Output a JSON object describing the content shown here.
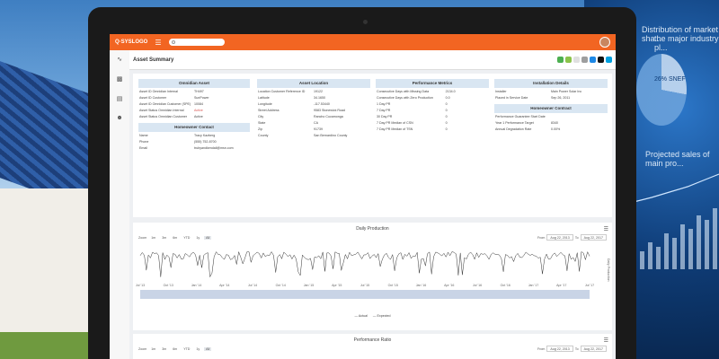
{
  "background": {
    "headline": "Distribution of market sha...",
    "subheadline": "the major industry pl...",
    "pie_label": "26% SNEF",
    "projected_text": "Projected sales of main pro..."
  },
  "app": {
    "brand": "Q·SYSLOGO",
    "page_title": "Asset Summary",
    "accent": "#f26522"
  },
  "omnidian": {
    "title": "Omnidian Asset",
    "rows": [
      {
        "k": "Asset ID Omnidian Internal",
        "v": "TH497"
      },
      {
        "k": "Asset ID Customer",
        "v": "SunPower"
      },
      {
        "k": "Asset ID Omnidian Customer (SPE)",
        "v": "10084"
      },
      {
        "k": "Asset Status Omnidian Internal",
        "v": "Active"
      },
      {
        "k": "Asset Status Omnidian Customer",
        "v": "Active"
      }
    ]
  },
  "homeowner": {
    "title": "Homeowner Contact",
    "rows": [
      {
        "k": "Name",
        "v": "Tracy Kazberg"
      },
      {
        "k": "Phone",
        "v": "(555) 752-8700"
      },
      {
        "k": "Email",
        "v": "trubyandkendall@msn.com"
      }
    ]
  },
  "location": {
    "title": "Asset Location",
    "rows": [
      {
        "k": "Location Customer Reference ID",
        "v": "19122"
      },
      {
        "k": "Latitude",
        "v": "34.1650"
      },
      {
        "k": "Longitude",
        "v": "-117.53440"
      },
      {
        "k": "Street Address",
        "v": "9583 Stonewick Road"
      },
      {
        "k": "City",
        "v": "Rancho Cucamonga"
      },
      {
        "k": "State",
        "v": "CA"
      },
      {
        "k": "Zip",
        "v": "91739"
      },
      {
        "k": "County",
        "v": "San Bernardino County"
      }
    ]
  },
  "performance": {
    "title": "Performance Metrics",
    "rows": [
      {
        "k": "Consecutive Days with Missing Data",
        "v": "2134.0"
      },
      {
        "k": "Consecutive Days with Zero Production",
        "v": "0.0"
      },
      {
        "k": "1 Day PR",
        "v": "0"
      },
      {
        "k": "7 Day PR",
        "v": "0"
      },
      {
        "k": "30 Day PR",
        "v": "0"
      },
      {
        "k": "7 Day PR Median of CSN",
        "v": "0"
      },
      {
        "k": "7 Day PR Median of TSN",
        "v": "0"
      }
    ]
  },
  "installation": {
    "title": "Installation Details",
    "rows": [
      {
        "k": "Installer",
        "v": "Main Power Solar Inc"
      },
      {
        "k": "Placed in Service Date",
        "v": "Sep 26, 2011"
      }
    ]
  },
  "homeowner_contract": {
    "title": "Homeowner Contract",
    "rows": [
      {
        "k": "Performance Guarantee Start Date",
        "v": ""
      },
      {
        "k": "Year 1 Performance Target",
        "v": "8340"
      },
      {
        "k": "Annual Degradation Rate",
        "v": "0.00%"
      }
    ]
  },
  "daily_chart": {
    "title": "Daily Production",
    "zoom_label": "Zoom",
    "zoom_options": [
      "1m",
      "3m",
      "6m",
      "YTD",
      "1y",
      "All"
    ],
    "active_zoom": "All",
    "from_label": "From",
    "to_label": "To",
    "from_date": "Aug 22, 2013",
    "to_date": "Aug 22, 2017",
    "x_ticks": [
      "Jul '13",
      "Oct '13",
      "Jan '14",
      "Apr '14",
      "Jul '14",
      "Oct '14",
      "Jan '15",
      "Apr '15",
      "Jul '15",
      "Oct '15",
      "Jan '16",
      "Apr '16",
      "Jul '16",
      "Oct '16",
      "Jan '17",
      "Apr '17",
      "Jul '17"
    ],
    "y_axis_label": "Daily Production",
    "legend_actual": "Actual",
    "legend_expected": "Expected"
  },
  "ratio_chart": {
    "title": "Performance Ratio",
    "zoom_label": "Zoom",
    "zoom_options": [
      "1m",
      "3m",
      "6m",
      "YTD",
      "1y",
      "All"
    ],
    "active_zoom": "All",
    "from_label": "From",
    "to_label": "To",
    "from_date": "Aug 22, 2013",
    "to_date": "Aug 22, 2017"
  },
  "icons": [
    "activity-icon",
    "bar-chart-icon",
    "document-icon",
    "user-icon"
  ]
}
